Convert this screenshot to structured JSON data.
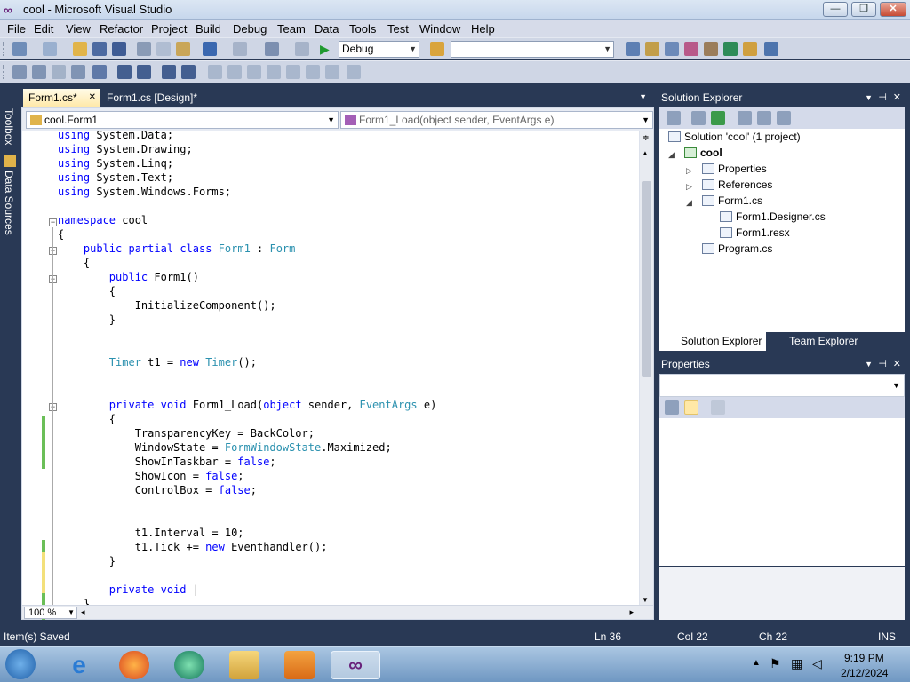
{
  "window": {
    "title": "cool - Microsoft Visual Studio",
    "minimize": "—",
    "maximize": "❐",
    "close": "✕"
  },
  "menu": [
    "File",
    "Edit",
    "View",
    "Refactor",
    "Project",
    "Build",
    "Debug",
    "Team",
    "Data",
    "Tools",
    "Test",
    "Window",
    "Help"
  ],
  "toolbar": {
    "config": "Debug",
    "platform": ""
  },
  "side_tabs": {
    "toolbox": "Toolbox",
    "data_sources": "Data Sources"
  },
  "tabs": [
    {
      "label": "Form1.cs*",
      "close": "✕"
    },
    {
      "label": "Form1.cs [Design]*"
    }
  ],
  "nav": {
    "class": "cool.Form1",
    "member": "Form1_Load(object sender, EventArgs e)"
  },
  "code": [
    "using System.Data;",
    "using System.Drawing;",
    "using System.Linq;",
    "using System.Text;",
    "using System.Windows.Forms;",
    "",
    "namespace cool",
    "{",
    "    public partial class Form1 : Form",
    "    {",
    "        public Form1()",
    "        {",
    "            InitializeComponent();",
    "        }",
    "",
    "",
    "        Timer t1 = new Timer();",
    "",
    "",
    "        private void Form1_Load(object sender, EventArgs e)",
    "        {",
    "            TransparencyKey = BackColor;",
    "            WindowState = FormWindowState.Maximized;",
    "            ShowInTaskbar = false;",
    "            ShowIcon = false;",
    "            ControlBox = false;",
    "",
    "",
    "            t1.Interval = 10;",
    "            t1.Tick += new Eventhandler();",
    "        }",
    "",
    "        private void |",
    "    }"
  ],
  "zoom": "100 %",
  "solution_explorer": {
    "title": "Solution Explorer",
    "items": [
      {
        "label": "Solution 'cool' (1 project)"
      },
      {
        "label": "cool"
      },
      {
        "label": "Properties"
      },
      {
        "label": "References"
      },
      {
        "label": "Form1.cs"
      },
      {
        "label": "Form1.Designer.cs"
      },
      {
        "label": "Form1.resx"
      },
      {
        "label": "Program.cs"
      }
    ],
    "bottom_tabs": [
      "Solution Explorer",
      "Team Explorer"
    ]
  },
  "properties": {
    "title": "Properties"
  },
  "status": {
    "message": "Item(s) Saved",
    "ln": "Ln 36",
    "col": "Col 22",
    "ch": "Ch 22",
    "mode": "INS"
  },
  "clock": {
    "time": "9:19 PM",
    "date": "2/12/2024"
  },
  "colors": {
    "accent": "#293955",
    "tab_active": "#ffe8a6",
    "keyword": "#0000ff",
    "type": "#2b91af"
  }
}
